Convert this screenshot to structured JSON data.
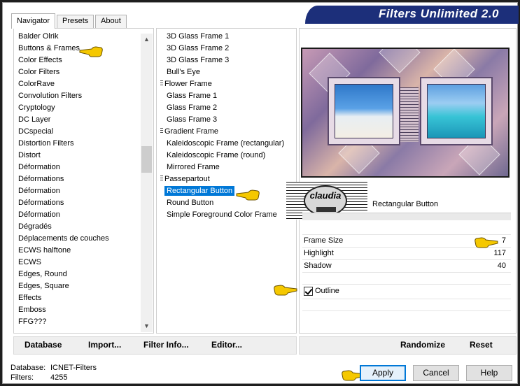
{
  "app": {
    "title": "Filters Unlimited 2.0"
  },
  "tabs": [
    {
      "label": "Navigator",
      "active": true
    },
    {
      "label": "Presets",
      "active": false
    },
    {
      "label": "About",
      "active": false
    }
  ],
  "categories": [
    "Balder Olrik",
    "Buttons & Frames",
    "Color Effects",
    "Color Filters",
    "ColorRave",
    "Convolution Filters",
    "Cryptology",
    "DC Layer",
    "DCspecial",
    "Distortion Filters",
    "Distort",
    "Déformation",
    "Déformations",
    "Déformation",
    "Déformations",
    "Déformation",
    "Dégradés",
    "Déplacements de couches",
    "ECWS halftone",
    "ECWS",
    "Edges, Round",
    "Edges, Square",
    "Effects",
    "Emboss",
    "FFG???"
  ],
  "filters": [
    {
      "label": "3D Glass Frame 1",
      "grip": false
    },
    {
      "label": "3D Glass Frame 2",
      "grip": false
    },
    {
      "label": "3D Glass Frame 3",
      "grip": false
    },
    {
      "label": "Bull's Eye",
      "grip": false
    },
    {
      "label": "Flower Frame",
      "grip": true
    },
    {
      "label": "Glass Frame 1",
      "grip": false
    },
    {
      "label": "Glass Frame 2",
      "grip": false
    },
    {
      "label": "Glass Frame 3",
      "grip": false
    },
    {
      "label": "Gradient Frame",
      "grip": true
    },
    {
      "label": "Kaleidoscopic Frame (rectangular)",
      "grip": false
    },
    {
      "label": "Kaleidoscopic Frame (round)",
      "grip": false
    },
    {
      "label": "Mirrored Frame",
      "grip": false
    },
    {
      "label": "Passepartout",
      "grip": true
    },
    {
      "label": "Rectangular Button",
      "grip": false,
      "selected": true
    },
    {
      "label": "Round Button",
      "grip": false
    },
    {
      "label": "Simple Foreground Color Frame",
      "grip": false
    }
  ],
  "logo": {
    "text": "claudia"
  },
  "selected_filter": "Rectangular Button",
  "params": [
    {
      "label": "Frame Size",
      "value": "7"
    },
    {
      "label": "Highlight",
      "value": "117"
    },
    {
      "label": "Shadow",
      "value": "40"
    }
  ],
  "outline": {
    "label": "Outline",
    "checked": true
  },
  "toolbar": {
    "database": "Database",
    "import": "Import...",
    "filter_info": "Filter Info...",
    "editor": "Editor...",
    "randomize": "Randomize",
    "reset": "Reset"
  },
  "status": {
    "database_label": "Database:",
    "database_value": "ICNET-Filters",
    "filters_label": "Filters:",
    "filters_value": "4255"
  },
  "buttons": {
    "apply": "Apply",
    "cancel": "Cancel",
    "help": "Help"
  },
  "colors": {
    "banner": "#1c2f7a",
    "selection": "#0078d7",
    "pointer": "#f5c800"
  }
}
